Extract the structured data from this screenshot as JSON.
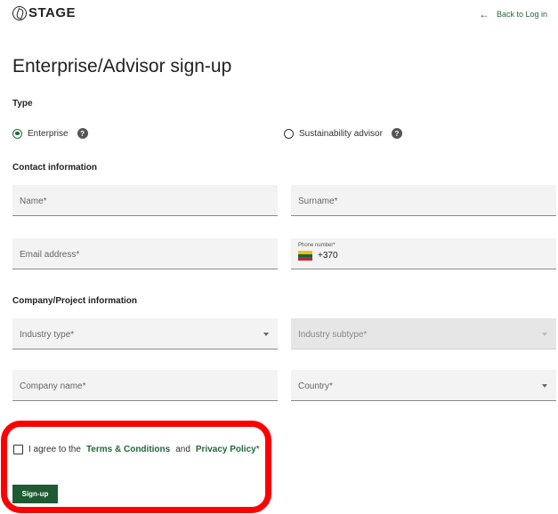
{
  "header": {
    "logo_text": "STAGE",
    "back_label": "Back to Log in"
  },
  "page": {
    "title": "Enterprise/Advisor sign-up"
  },
  "type_section": {
    "label": "Type",
    "options": [
      {
        "label": "Enterprise",
        "checked": true
      },
      {
        "label": "Sustainability advisor",
        "checked": false
      }
    ]
  },
  "contact": {
    "label": "Contact information",
    "name_placeholder": "Name*",
    "surname_placeholder": "Surname*",
    "email_placeholder": "Email address*",
    "phone_label": "Phone number*",
    "phone_code": "+370"
  },
  "company": {
    "label": "Company/Project information",
    "industry_type_placeholder": "Industry type*",
    "industry_subtype_placeholder": "Industry subtype*",
    "company_name_placeholder": "Company name*",
    "country_placeholder": "Country*"
  },
  "agreement": {
    "prefix": "I agree to the",
    "terms_label": "Terms & Conditions",
    "and_text": "and",
    "privacy_label": "Privacy Policy",
    "suffix": "*"
  },
  "signup_label": "Sign-up",
  "colors": {
    "accent": "#1e6b38",
    "button": "#1e5b32",
    "highlight": "#ff0000",
    "flag": [
      "#fdb913",
      "#006a44",
      "#c1272d"
    ]
  }
}
